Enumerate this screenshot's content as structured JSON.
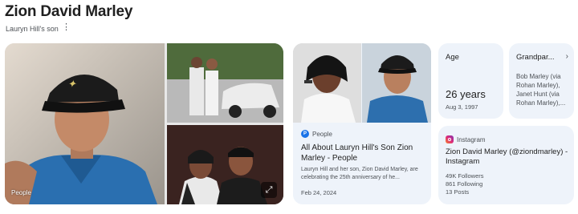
{
  "header": {
    "title": "Zion David Marley",
    "subtitle": "Lauryn Hill's son",
    "more_glyph": "⋮"
  },
  "gallery": {
    "main_photo_credit": "People",
    "expand_glyph": "⤢"
  },
  "article": {
    "source": "People",
    "title": "All About Lauryn Hill's Son Zion Marley - People",
    "snippet": "Lauryn Hill and her son, Zion David Marley, are celebrating the 25th anniversary of he...",
    "date": "Feb 24, 2024"
  },
  "age_card": {
    "label": "Age",
    "value": "26 years",
    "birthdate": "Aug 3, 1997"
  },
  "grandparents_card": {
    "label": "Grandpar...",
    "chevron": "›",
    "entries": [
      "Bob Marley (via Rohan Marley),",
      "Janet Hunt (via Rohan Marley),..."
    ]
  },
  "instagram_card": {
    "source": "Instagram",
    "title": "Zion David Marley (@ziondmarley) - Instagram",
    "followers": "49K Followers",
    "following": "861 Following",
    "posts": "13 Posts"
  }
}
